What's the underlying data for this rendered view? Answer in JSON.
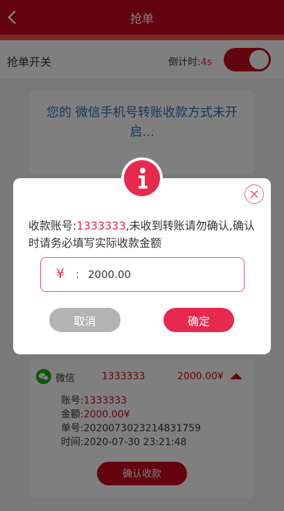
{
  "header": {
    "title": "抢单"
  },
  "switch_row": {
    "label": "抢单开关",
    "countdown_label": "倒计时:",
    "countdown_value": "4s",
    "toggle_on": true
  },
  "notice": {
    "text": "您的 微信手机号转账收款方式未开启..."
  },
  "order": {
    "method": "微信",
    "account": "1333333",
    "amount": "2000.00¥",
    "details": {
      "account_label": "账号:",
      "account_value": "1333333",
      "amount_label": "金额:",
      "amount_value": "2000.00¥",
      "order_no_label": "单号:",
      "order_no_value": "2020073023214831759",
      "time_label": "时间:",
      "time_value": "2020-07-30 23:21:48"
    },
    "confirm_label": "确认收款"
  },
  "modal": {
    "msg_prefix": "收款账号:",
    "msg_account": "1333333",
    "msg_suffix": ",未收到转账请勿确认,确认时请务必填写实际收款金额",
    "currency": "¥",
    "colon": ":",
    "amount_value": "2000.00",
    "cancel_label": "取消",
    "ok_label": "确定"
  },
  "colors": {
    "primary": "#c8081e",
    "accent": "#e8294e",
    "link": "#2a6fb5",
    "wechat": "#1aad19"
  }
}
